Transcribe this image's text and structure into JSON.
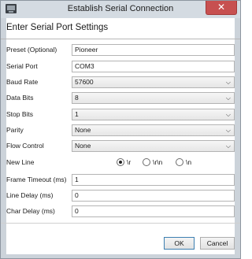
{
  "window": {
    "title": "Establish Serial Connection",
    "close_glyph": "✕"
  },
  "heading": "Enter Serial Port Settings",
  "preset": {
    "label": "Preset (Optional)",
    "value": "Pioneer"
  },
  "serial_port": {
    "label": "Serial Port",
    "value": "COM3"
  },
  "baud_rate": {
    "label": "Baud Rate",
    "value": "57600"
  },
  "data_bits": {
    "label": "Data Bits",
    "value": "8"
  },
  "stop_bits": {
    "label": "Stop Bits",
    "value": "1"
  },
  "parity": {
    "label": "Parity",
    "value": "None"
  },
  "flow_control": {
    "label": "Flow Control",
    "value": "None"
  },
  "new_line": {
    "label": "New Line",
    "options": [
      {
        "label": "\\r",
        "selected": true
      },
      {
        "label": "\\r\\n",
        "selected": false
      },
      {
        "label": "\\n",
        "selected": false
      }
    ]
  },
  "frame_timeout": {
    "label": "Frame Timeout (ms)",
    "value": "1"
  },
  "line_delay": {
    "label": "Line Delay (ms)",
    "value": "0"
  },
  "char_delay": {
    "label": "Char Delay (ms)",
    "value": "0"
  },
  "buttons": {
    "ok": "OK",
    "cancel": "Cancel"
  },
  "icons": {
    "dropdown": "chevron-down-icon",
    "app": "serial-port-icon",
    "close": "close-icon"
  },
  "colors": {
    "close_button": "#c75050",
    "window_frame": "#ccd3da",
    "ok_border": "#3c7fb1"
  }
}
